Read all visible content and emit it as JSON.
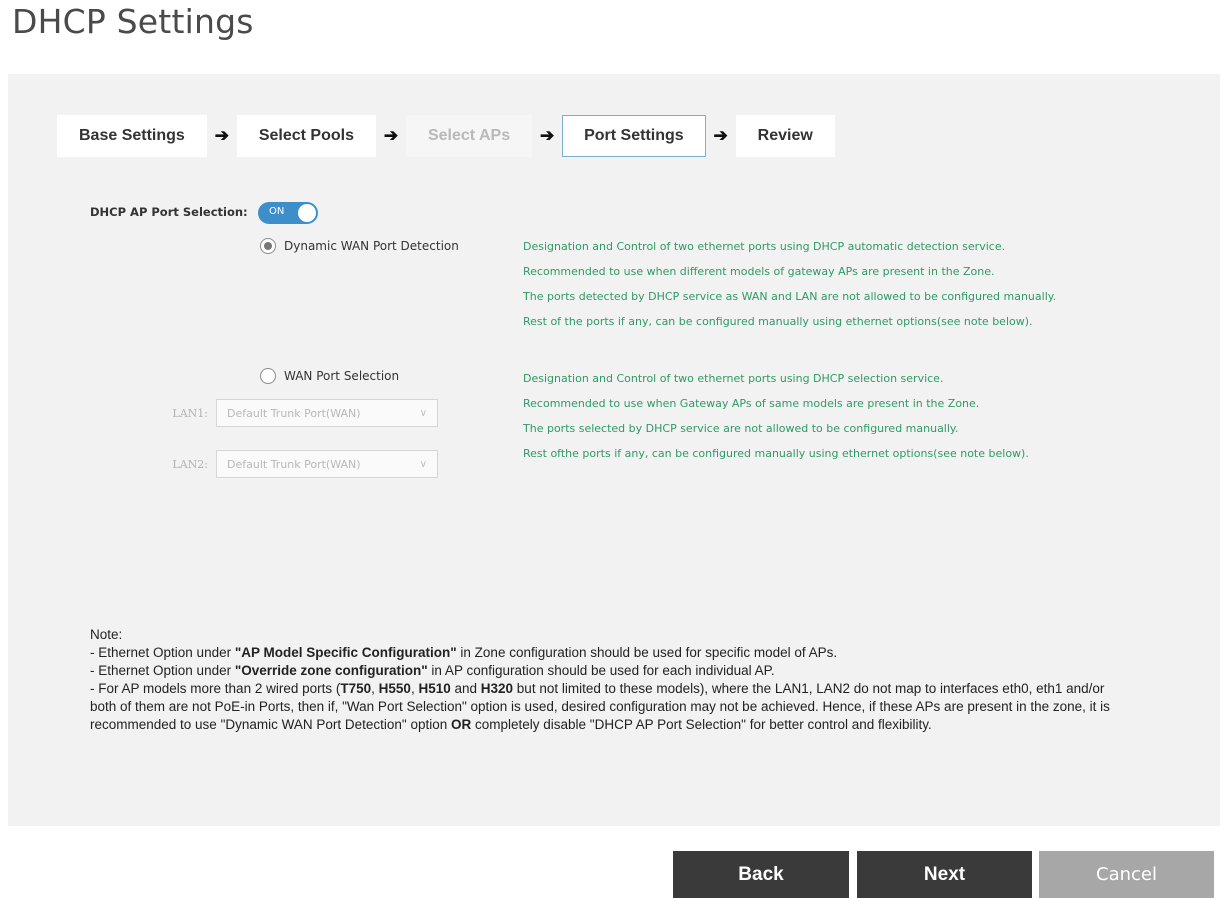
{
  "page": {
    "title": "DHCP Settings"
  },
  "stepper": {
    "steps": [
      {
        "label": "Base Settings",
        "state": "normal"
      },
      {
        "label": "Select Pools",
        "state": "normal"
      },
      {
        "label": "Select APs",
        "state": "disabled"
      },
      {
        "label": "Port Settings",
        "state": "active"
      },
      {
        "label": "Review",
        "state": "normal"
      }
    ],
    "arrow_icon": "arrow-right-icon"
  },
  "port_selection": {
    "label": "DHCP AP Port Selection:",
    "toggle_text": "ON",
    "toggle_state": true,
    "toggle_color": "#3e8fc9"
  },
  "dynamic_wan": {
    "label": "Dynamic WAN Port Detection",
    "selected": true,
    "description": [
      "Designation and Control of two ethernet ports using DHCP automatic detection service.",
      "Recommended to use when different models of gateway APs are present in the Zone.",
      "The ports detected by DHCP service as WAN and LAN are not allowed to be configured manually.",
      "Rest of the ports if any, can be configured manually using ethernet options(see note below)."
    ]
  },
  "wan_selection": {
    "label": "WAN Port Selection",
    "selected": false,
    "lan1_label": "LAN1:",
    "lan1_value": "Default Trunk Port(WAN)",
    "lan2_label": "LAN2:",
    "lan2_value": "Default Trunk Port(WAN)",
    "description": [
      "Designation and Control of two ethernet ports using DHCP selection service.",
      "Recommended to use when Gateway APs of same models are present in the Zone.",
      "The ports selected by DHCP service are not allowed to be configured manually.",
      "Rest ofthe ports if any, can be configured manually using ethernet options(see note below)."
    ]
  },
  "notes": {
    "heading": "Note:",
    "line1_prefix": "- Ethernet Option under ",
    "line1_bold": "\"AP Model Specific Configuration\"",
    "line1_suffix": " in Zone configuration should be used for specific model of APs.",
    "line2_prefix": "- Ethernet Option under ",
    "line2_bold": "\"Override zone configuration\"",
    "line2_suffix": " in AP configuration should be used for each individual AP.",
    "line3_prefix": "- For AP models more than 2 wired ports (",
    "model1": "T750",
    "sep1": ", ",
    "model2": "H550",
    "sep2": ", ",
    "model3": "H510",
    "sep3": " and ",
    "model4": "H320",
    "line3_suffix": " but not limited to these models), where the LAN1, LAN2 do not map to interfaces eth0, eth1 and/or both of them are not PoE-in Ports, then if, \"Wan Port Selection\" option is used, desired configuration may not be achieved. Hence, if these APs are present in the zone, it is recommended to use \"Dynamic WAN Port Detection\" option ",
    "or_text": "OR",
    "line3_end": " completely disable \"DHCP AP Port Selection\" for better control and flexibility."
  },
  "footer": {
    "back": "Back",
    "next": "Next",
    "cancel": "Cancel"
  }
}
